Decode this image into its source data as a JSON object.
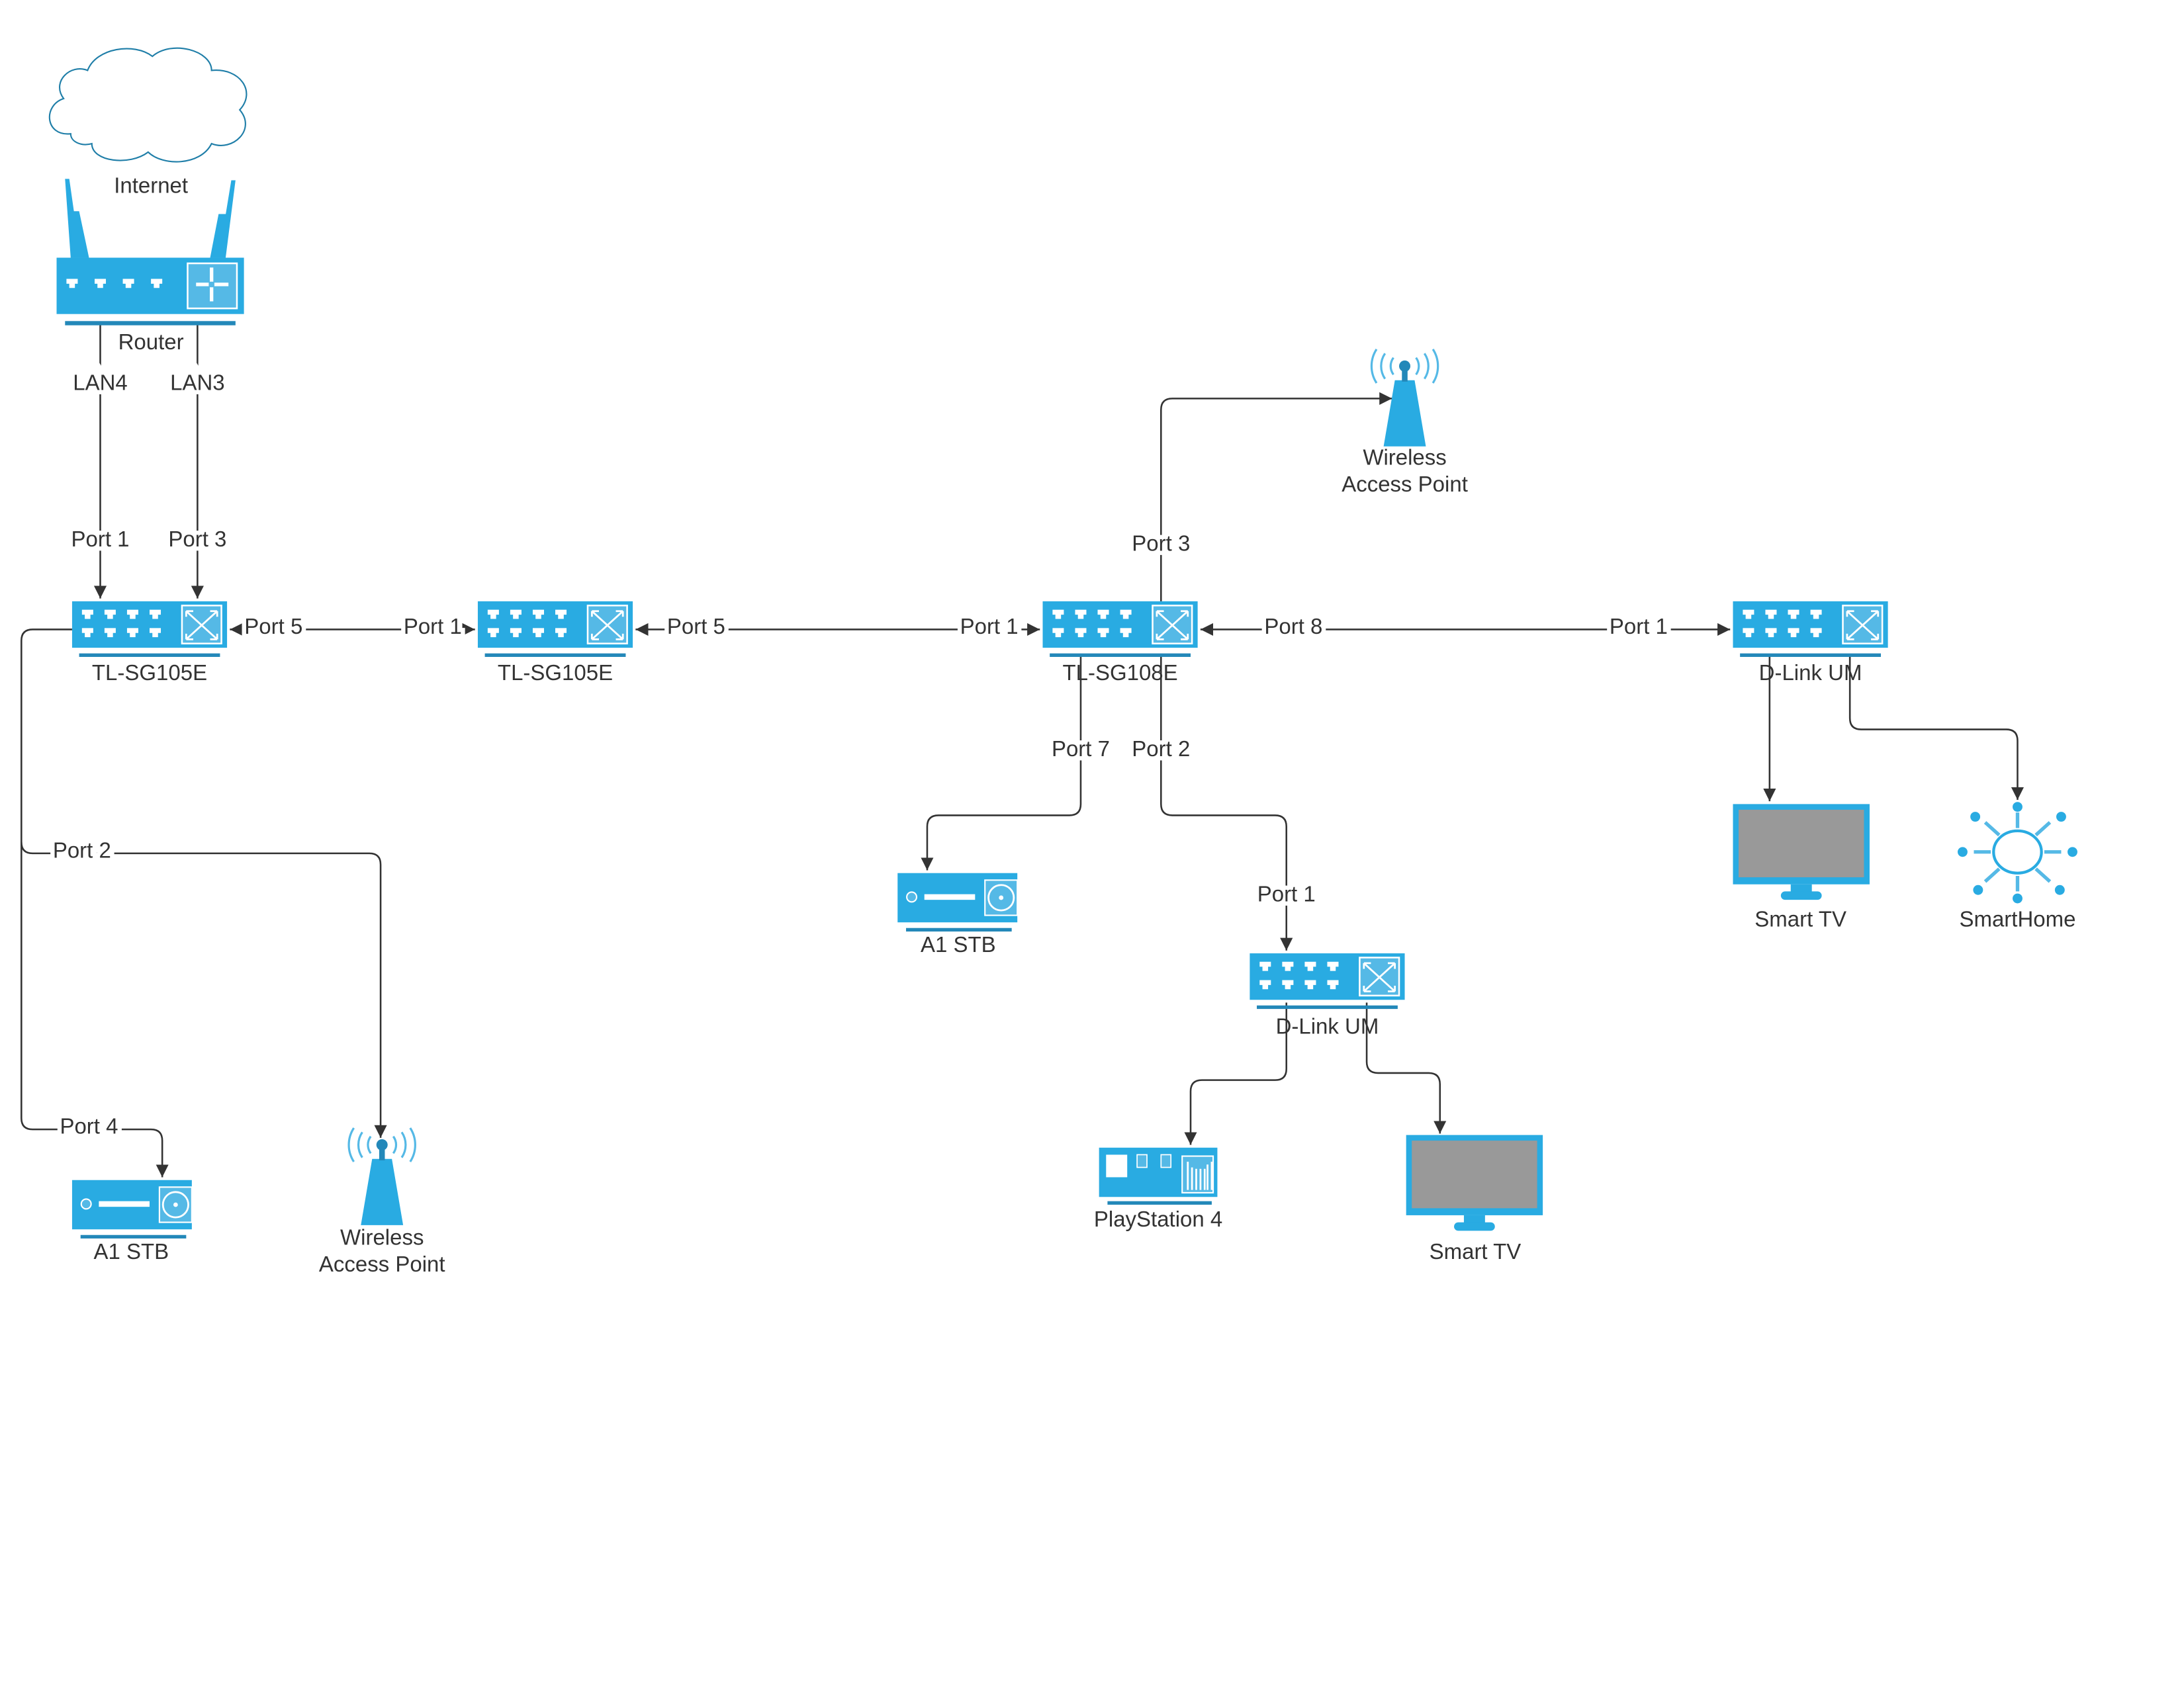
{
  "colors": {
    "device": "#29abe2",
    "device_dark": "#2388b9",
    "device_light": "#55b9e6",
    "connector": "#333333",
    "cloud": "#1f7ea8"
  },
  "nodes": {
    "internet": {
      "label": "Internet",
      "icon": "cloud-icon"
    },
    "router": {
      "label": "Router",
      "icon": "router-icon"
    },
    "switch_1": {
      "label": "TL-SG105E",
      "icon": "switch-icon"
    },
    "switch_2": {
      "label": "TL-SG105E",
      "icon": "switch-icon"
    },
    "switch_3": {
      "label": "TL-SG108E",
      "icon": "switch-icon"
    },
    "dlink_right": {
      "label": "D-Link UM",
      "icon": "switch-icon"
    },
    "dlink_mid": {
      "label": "D-Link UM",
      "icon": "switch-icon"
    },
    "ap_top": {
      "label_line1": "Wireless",
      "label_line2": "Access Point",
      "icon": "wireless-access-point-icon"
    },
    "ap_left": {
      "label_line1": "Wireless",
      "label_line2": "Access Point",
      "icon": "wireless-access-point-icon"
    },
    "stb_mid": {
      "label": "A1 STB",
      "icon": "set-top-box-icon"
    },
    "stb_left": {
      "label": "A1 STB",
      "icon": "set-top-box-icon"
    },
    "ps4": {
      "label": "PlayStation 4",
      "icon": "game-console-icon"
    },
    "tv_mid": {
      "label": "Smart TV",
      "icon": "tv-icon"
    },
    "tv_right": {
      "label": "Smart TV",
      "icon": "tv-icon"
    },
    "smarthome": {
      "label": "SmartHome",
      "icon": "smarthome-hub-icon"
    }
  },
  "edges": {
    "router_sw1": {
      "from": "LAN4",
      "to": "Port 1"
    },
    "router_sw1b": {
      "from": "LAN3",
      "to": "Port 3"
    },
    "sw1_sw2": {
      "from": "Port 5",
      "to": "Port 1"
    },
    "sw2_sw3": {
      "from": "Port 5",
      "to": "Port 1"
    },
    "sw3_dlink": {
      "from": "Port 8",
      "to": "Port 1"
    },
    "sw3_ap": {
      "from": "Port 3"
    },
    "sw3_stb": {
      "from": "Port 7"
    },
    "sw3_dlinkmid": {
      "from": "Port 2",
      "to": "Port 1"
    },
    "sw1_ap": {
      "from": "Port 2"
    },
    "sw1_stb": {
      "from": "Port 4"
    }
  }
}
